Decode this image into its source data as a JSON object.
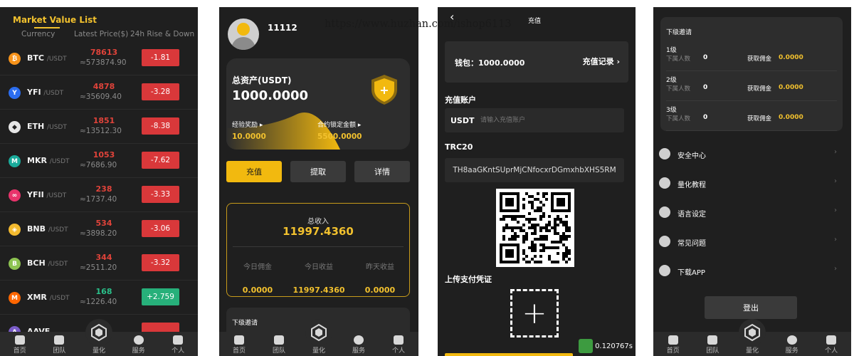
{
  "watermark": "https://www.huzhan.com/ishop6113",
  "nav": [
    {
      "label": "首页",
      "icon": "home-icon"
    },
    {
      "label": "团队",
      "icon": "team-icon"
    },
    {
      "label": "量化",
      "icon": "quant-logo-icon"
    },
    {
      "label": "服务",
      "icon": "service-icon"
    },
    {
      "label": "个人",
      "icon": "profile-icon"
    }
  ],
  "market": {
    "title": "Market Value List",
    "headers": {
      "currency": "Currency",
      "price": "Latest Price($)",
      "change": "24h Rise & Down"
    },
    "coins": [
      {
        "symbol": "BTC",
        "pair": "/USDT",
        "price": "78613",
        "cny": "≈573874.90",
        "change": "-1.81",
        "dir": "down",
        "color": "#f7931a",
        "glyph": "₿"
      },
      {
        "symbol": "YFI",
        "pair": "/USDT",
        "price": "4878",
        "cny": "≈35609.40",
        "change": "-3.28",
        "dir": "down",
        "color": "#2b6def",
        "glyph": "Y"
      },
      {
        "symbol": "ETH",
        "pair": "/USDT",
        "price": "1851",
        "cny": "≈13512.30",
        "change": "-8.38",
        "dir": "down",
        "color": "#e6e6e6",
        "glyph": "◆"
      },
      {
        "symbol": "MKR",
        "pair": "/USDT",
        "price": "1053",
        "cny": "≈7686.90",
        "change": "-7.62",
        "dir": "down",
        "color": "#1aab9b",
        "glyph": "M"
      },
      {
        "symbol": "YFII",
        "pair": "/USDT",
        "price": "238",
        "cny": "≈1737.40",
        "change": "-3.33",
        "dir": "down",
        "color": "#e8336b",
        "glyph": "∞"
      },
      {
        "symbol": "BNB",
        "pair": "/USDT",
        "price": "534",
        "cny": "≈3898.20",
        "change": "-3.06",
        "dir": "down",
        "color": "#f3ba2f",
        "glyph": "◈"
      },
      {
        "symbol": "BCH",
        "pair": "/USDT",
        "price": "344",
        "cny": "≈2511.20",
        "change": "-3.32",
        "dir": "down",
        "color": "#8dc351",
        "glyph": "B"
      },
      {
        "symbol": "XMR",
        "pair": "/USDT",
        "price": "168",
        "cny": "≈1226.40",
        "change": "+2.759",
        "dir": "up",
        "color": "#ff6600",
        "glyph": "M"
      },
      {
        "symbol": "AAVE",
        "pair": "",
        "price": "",
        "cny": "",
        "change": "",
        "dir": "down",
        "color": "#7a5cc8",
        "glyph": "A"
      }
    ]
  },
  "profile": {
    "uid": "11112",
    "total_label": "总资产(USDT)",
    "total_value": "1000.0000",
    "exp_label": "经验奖励 ▸",
    "exp_value": "10.0000",
    "lock_label": "合约锁定金额 ▸",
    "lock_value": "5500.0000",
    "buttons": [
      "充值",
      "提取",
      "详情"
    ],
    "income_title": "总收入",
    "income_value": "11997.4360",
    "income_cols": [
      {
        "label": "今日佣金",
        "value": "0.0000"
      },
      {
        "label": "今日收益",
        "value": "11997.4360"
      },
      {
        "label": "昨天收益",
        "value": "0.0000"
      }
    ],
    "invite_title": "下级邀请"
  },
  "recharge": {
    "title": "充值",
    "wallet": "钱包：1000.0000",
    "record": "充值记录 ›",
    "account_label": "充值账户",
    "currency": "USDT",
    "account_placeholder": "请输入充值账户",
    "network": "TRC20",
    "address": "TH8aaGKntSUprMjCNfocxrDGmxhbXHS5RM",
    "upload_label": "上传支付凭证",
    "speed": "0.120767s"
  },
  "settings": {
    "invite_title": "下级邀请",
    "levels": [
      {
        "level": "1级",
        "count_label": "下属人数",
        "count": "0",
        "commission_label": "获取佣金",
        "commission": "0.0000"
      },
      {
        "level": "2级",
        "count_label": "下属人数",
        "count": "0",
        "commission_label": "获取佣金",
        "commission": "0.0000"
      },
      {
        "level": "3级",
        "count_label": "下属人数",
        "count": "0",
        "commission_label": "获取佣金",
        "commission": "0.0000"
      }
    ],
    "menu": [
      {
        "label": "安全中心",
        "icon": "shield-icon"
      },
      {
        "label": "量化教程",
        "icon": "quant-logo-icon"
      },
      {
        "label": "语言设定",
        "icon": "globe-icon"
      },
      {
        "label": "常见问题",
        "icon": "question-icon"
      },
      {
        "label": "下载APP",
        "icon": "download-icon"
      }
    ],
    "logout": "登出"
  }
}
